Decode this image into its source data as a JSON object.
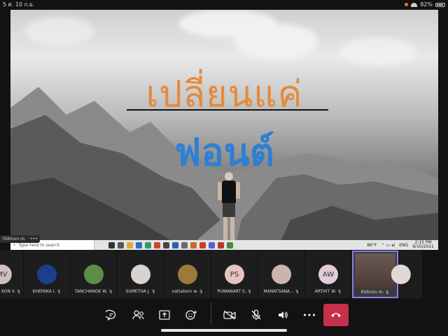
{
  "status_bar": {
    "left_text": "5  ศ. 10 ก.ย.",
    "battery": "82%"
  },
  "shared_screen": {
    "title_line1": "เปลี่ยนแค่",
    "title_line2": "ฟอนต์",
    "taskbar": {
      "search_placeholder": "Type here to search",
      "weather": "86°F",
      "language": "ENG",
      "time": "2:15 PM",
      "date": "9/10/2021"
    }
  },
  "pinned_label": "thitinon m.",
  "participants": [
    {
      "initials": "MV",
      "name": "KON V.",
      "avatar_color": "#cfc0bf",
      "kind": "initials"
    },
    {
      "initials": "",
      "name": "KHEMIKA I.",
      "avatar_color": "#1d3d8f",
      "kind": "photo"
    },
    {
      "initials": "",
      "name": "TANCHANOK W.",
      "avatar_color": "#5e8d4a",
      "kind": "photo"
    },
    {
      "initials": "",
      "name": "SUMETHA J.",
      "avatar_color": "#d8d3cf",
      "kind": "photo"
    },
    {
      "initials": "",
      "name": "nattakorn w.",
      "avatar_color": "#9a7b3c",
      "kind": "photo"
    },
    {
      "initials": "PS",
      "name": "PUWANART S.",
      "avatar_color": "#e7c3bd",
      "kind": "initials"
    },
    {
      "initials": "",
      "name": "MANATSANA...",
      "avatar_color": "#c9b4ae",
      "kind": "photo"
    },
    {
      "initials": "AW",
      "name": "ARTHIT W.",
      "avatar_color": "#e2cbd8",
      "kind": "initials"
    },
    {
      "initials": "",
      "name": "thitinon m.",
      "avatar_color": "#6b5a55",
      "kind": "video"
    },
    {
      "initials": "",
      "name": "",
      "avatar_color": "#e2d8d4",
      "kind": "photo"
    }
  ],
  "controls": {
    "chat": "chat-icon",
    "people": "people-icon",
    "share": "share-tray-icon",
    "reactions": "reactions-icon",
    "camera": "camera-off-icon",
    "mic": "mic-off-icon",
    "speaker": "speaker-icon",
    "more": "more-icon",
    "leave": "hang-up-icon",
    "more_glyph": "•••"
  }
}
